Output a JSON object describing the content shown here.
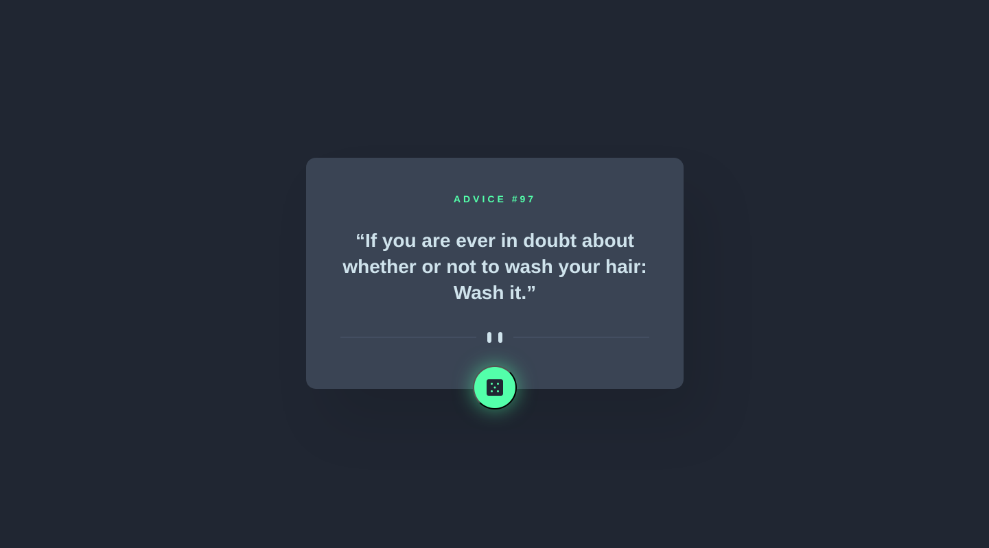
{
  "advice": {
    "id_label": "ADVICE #97",
    "quote": "“If you are ever in doubt about whether or not to wash your hair: Wash it.”"
  },
  "divider": {
    "icon": "pause-icon"
  },
  "action": {
    "icon": "dice-icon"
  },
  "colors": {
    "background": "#202632",
    "card": "#3A4454",
    "accent": "#53FFAA",
    "text": "#CFE3EC",
    "divider": "#4F5D74"
  }
}
